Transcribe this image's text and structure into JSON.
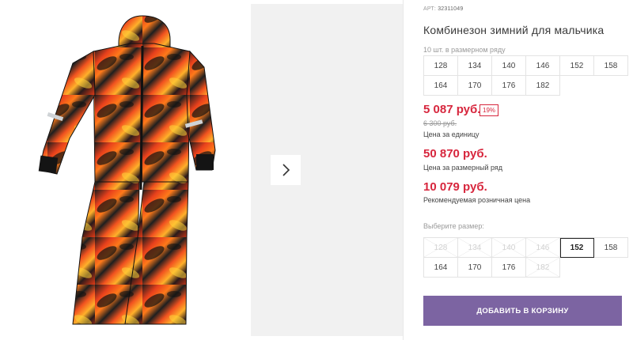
{
  "product": {
    "article_prefix": "АРТ:",
    "article": "32311049",
    "title": "Комбинезон зимний для мальчика",
    "row_note": "10 шт. в размерном ряду",
    "row_sizes": [
      "128",
      "134",
      "140",
      "146",
      "152",
      "158",
      "164",
      "170",
      "176",
      "182"
    ]
  },
  "pricing": {
    "unit_price": "5 087 руб.",
    "discount": "19%",
    "old_price": "6 300 руб.",
    "unit_caption": "Цена за единицу",
    "row_price": "50 870 руб.",
    "row_caption": "Цена за размерный ряд",
    "retail_price": "10 079 руб.",
    "retail_caption": "Рекомендуемая розничная цена"
  },
  "size_picker": {
    "label": "Выберите размер:",
    "options": [
      {
        "label": "128",
        "available": false
      },
      {
        "label": "134",
        "available": false
      },
      {
        "label": "140",
        "available": false
      },
      {
        "label": "146",
        "available": false
      },
      {
        "label": "152",
        "available": true,
        "selected": true
      },
      {
        "label": "158",
        "available": true
      },
      {
        "label": "164",
        "available": true
      },
      {
        "label": "170",
        "available": true
      },
      {
        "label": "176",
        "available": true
      },
      {
        "label": "182",
        "available": false
      }
    ]
  },
  "cart_button": "ДОБАВИТЬ В КОРЗИНУ",
  "colors": {
    "price_red": "#d7263d",
    "button_purple": "#7c64a2",
    "gallery_bg": "#f1f1f1"
  },
  "icons": {
    "next": "chevron-right-icon"
  }
}
